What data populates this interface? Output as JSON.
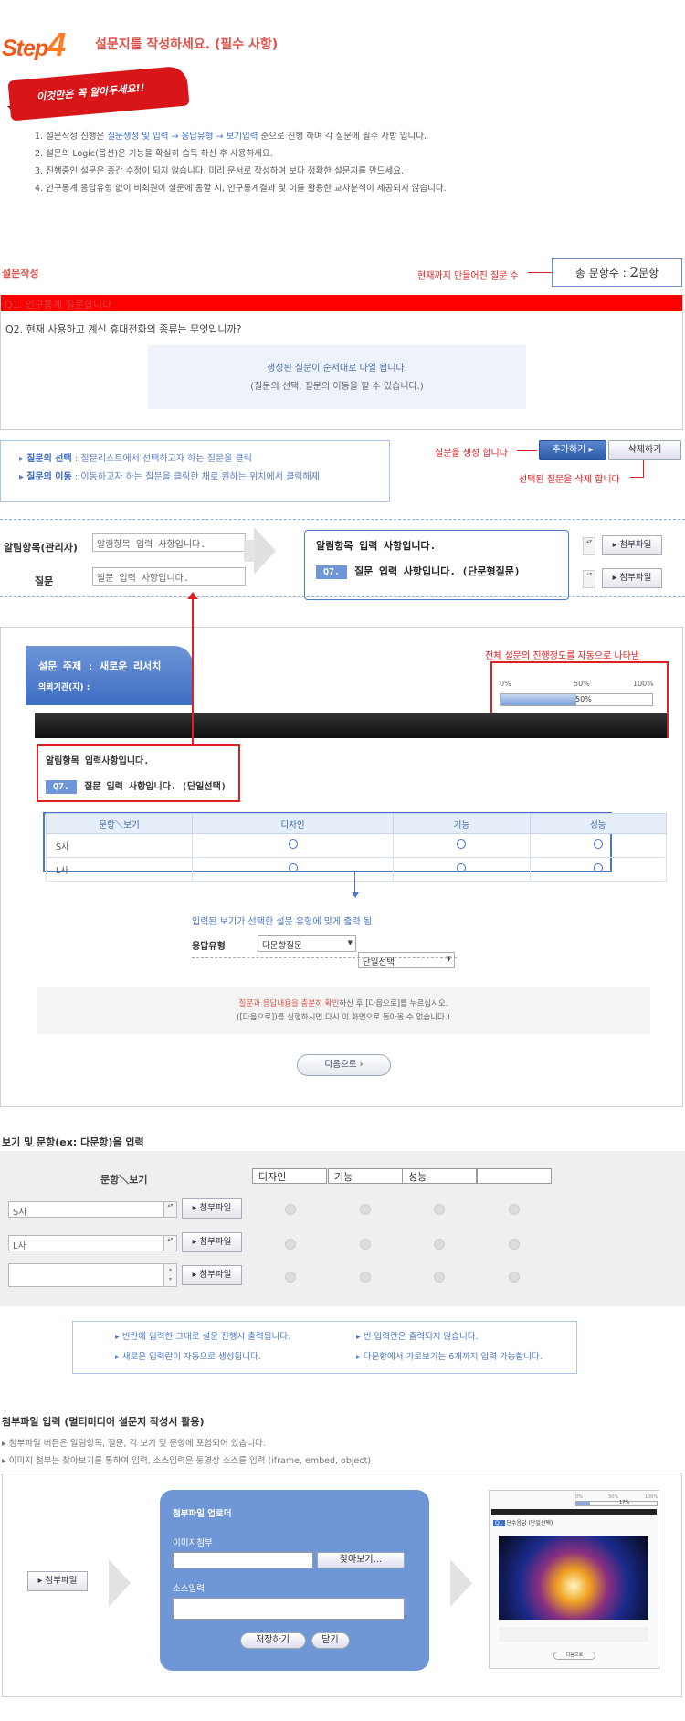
{
  "header": {
    "step_word": "Step",
    "step_number": "4",
    "title": "설문지를 작성하세요. (필수 사항)"
  },
  "ribbon": "이것만은 꼭 알아두세요!!",
  "rules": [
    {
      "pre": "1. 설문작성 진행은 ",
      "hl": "질문생성 및 입력 → 응답유형 → 보기입력",
      "post": " 순으로 진행 하며 각 질문에 필수 사항 입니다."
    },
    {
      "pre": "2. 설문의 Logic(옵션)은 기능을 확실히 습득 하신 후 사용하세요.",
      "hl": "",
      "post": ""
    },
    {
      "pre": "3. 진행중인 설문은 중간 수정이 되지 않습니다. 미리 문서로 작성하여 보다 정확한 설문지를 만드세요.",
      "hl": "",
      "post": ""
    },
    {
      "pre": "4. 인구통계 응답유형 없이 비회원이 설문에 응할 시, 인구통계결과 및 이를 활용한 교차분석이 제공되지 않습니다.",
      "hl": "",
      "post": ""
    }
  ],
  "compose": {
    "title": "설문작성",
    "count_note": "현재까지 만들어진 질문 수",
    "count_label": "총 문항수 :",
    "count_value": "2",
    "count_unit": "문항",
    "q1": "Q1. 인구통계 질문합니다",
    "q2": "Q2. 현재 사용하고 계신 휴대전화의 종류는 무엇입니까?",
    "info_main": "생성된 질문이 순서대로 나열 됩니다.",
    "info_sub": "(질문의 선택, 질문의 이동을 할 수 있습니다.)"
  },
  "guide": {
    "select_label": "질문의 선택",
    "select_text": ": 질문리스트에서 선택하고자 하는 질문을 클릭",
    "move_label": "질문의 이동",
    "move_text": ": 이동하고자 하는 질문을 클릭한 채로 원하는 위치에서 클릭해제"
  },
  "actions": {
    "add_note": "질문을 생성 합니다",
    "add_label": "추가하기",
    "delete_label": "삭제하기",
    "delete_note": "선택된 질문을 삭제 합니다"
  },
  "editor": {
    "notice_label": "알림항목(관리자)",
    "notice_value": "알림항목 입력 사항입니다.",
    "question_label": "질문",
    "question_value": "질문 입력 사항입니다.",
    "attach_label": "첨부파일"
  },
  "preview_card": {
    "notice": "알림항목 입력 사항입니다.",
    "tag": "Q7.",
    "question": "질문 입력 사항입니다. (단문형질문)"
  },
  "survey": {
    "topic": "설문 주제 : 새로운 리서치",
    "org": "의뢰기관(자) :",
    "progress_note": "전체 설문의 진행정도를 자동으로 나타냄",
    "progress_ticks": [
      "0%",
      "50%",
      "100%"
    ],
    "progress_value": "50%",
    "progress_fraction": 0.5,
    "notice": "알림항목 입력사항입니다.",
    "tag": "Q7.",
    "question": "질문 입력 사항입니다. (단일선택)",
    "matrix_header": [
      "문항＼보기",
      "디자인",
      "기능",
      "성능"
    ],
    "matrix_rows": [
      "S사",
      "L사"
    ],
    "output_note": "입력된 보기가 선택한 설문 유형에 맞게 출력 됨",
    "response_label": "응답유형",
    "select1": "다문항질문",
    "select2": "단일선택",
    "notice_red": "질문과 응답내용을 충분히 확인",
    "notice_rest": "하신 후 [다음으로]를 누르십시오.",
    "notice_line2": "([다음으로])를 실행하시면 다시 이 화면으로 돌아올 수 없습니다.)",
    "next_label": "다음으로"
  },
  "options": {
    "title": "보기 및 문항(ex: 다문항)을 입력",
    "col_header": "문항＼보기",
    "choices": [
      "디자인",
      "기능",
      "성능",
      ""
    ],
    "rows": [
      "S사",
      "L사",
      ""
    ],
    "attach_label": "첨부파일",
    "info": [
      "빈칸에 입력한 그대로 설문 진행시 출력됩니다.",
      "빈 입력란은 출력되지 않습니다.",
      "새로운 입력란이 자동으로 생성됩니다.",
      "다문항에서 가로보기는 6개까지 입력 가능합니다."
    ]
  },
  "attachments": {
    "title": "첨부파일 입력 (멀티미디어 설문지 작성시 활용)",
    "bullets": [
      "첨부파일 버튼은 알림항목, 질문, 각 보기 및 문항에 포함되어 있습니다.",
      "이미지 첨부는 찾아보기를 통하여 입력, 소스입력은 동영상 소스를 입력 (iframe, embed, object)"
    ],
    "button": "첨부파일",
    "modal_title": "첨부파일 업로더",
    "image_label": "이미지첨부",
    "browse": "찾아보기...",
    "source_label": "소스입력",
    "save": "저장하기",
    "close": "닫기",
    "thumb_ticks": [
      "0%",
      "50%",
      "100%"
    ],
    "thumb_prog": "17%",
    "thumb_tag": "Q1",
    "thumb_title": "단수응답 (단일선택)",
    "thumb_next": "다음으로"
  },
  "colors": {
    "accent": "#e0524a",
    "blue": "#4a78c8",
    "red": "#e02020"
  }
}
